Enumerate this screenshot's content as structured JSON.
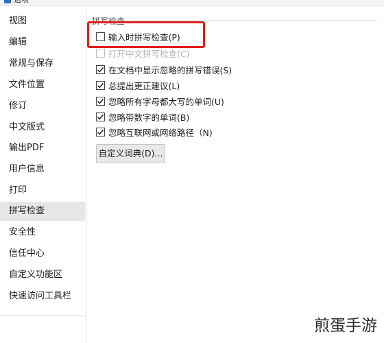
{
  "window": {
    "title": "选项"
  },
  "sidebar": {
    "items": [
      {
        "label": "视图"
      },
      {
        "label": "编辑"
      },
      {
        "label": "常规与保存"
      },
      {
        "label": "文件位置"
      },
      {
        "label": "修订"
      },
      {
        "label": "中文版式"
      },
      {
        "label": "输出PDF"
      },
      {
        "label": "用户信息"
      },
      {
        "label": "打印"
      },
      {
        "label": "拼写检查",
        "selected": true
      },
      {
        "label": "安全性"
      },
      {
        "label": "信任中心"
      },
      {
        "label": "自定义功能区"
      },
      {
        "label": "快速访问工具栏"
      }
    ]
  },
  "main": {
    "section_title": "拼写检查",
    "options": [
      {
        "label": "输入时拼写检查(P)",
        "checked": false,
        "enabled": true
      },
      {
        "label": "打开中文拼写检查(C)",
        "checked": false,
        "enabled": false
      },
      {
        "label": "在文档中显示忽略的拼写错误(S)",
        "checked": true,
        "enabled": true
      },
      {
        "label": "总提出更正建议(L)",
        "checked": true,
        "enabled": true
      },
      {
        "label": "忽略所有字母都大写的单词(U)",
        "checked": true,
        "enabled": true
      },
      {
        "label": "忽略带数字的单词(B)",
        "checked": true,
        "enabled": true
      },
      {
        "label": "忽略互联网或网络路径（N)",
        "checked": true,
        "enabled": true
      }
    ],
    "custom_dictionary_button": "自定义词典(D)..."
  },
  "annotation": {
    "highlight_color": "#e0201e"
  },
  "watermark": {
    "text": "煎蛋手游"
  },
  "colors": {
    "selected_bg": "#e6e6e6",
    "disabled_text": "#b4b4b4"
  }
}
